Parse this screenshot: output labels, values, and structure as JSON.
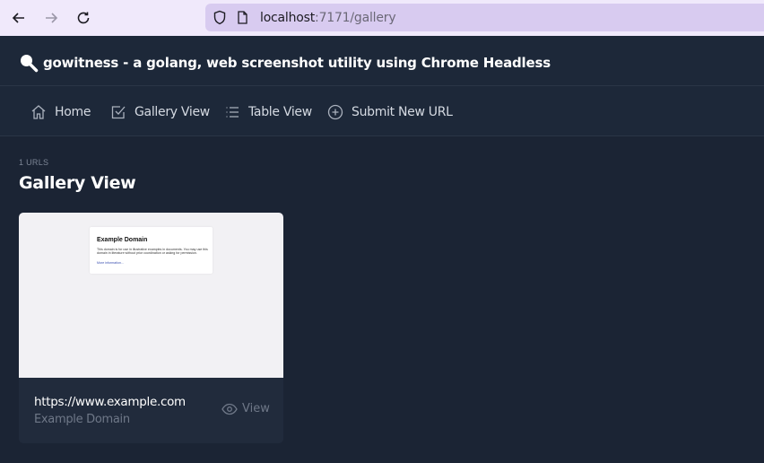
{
  "browser": {
    "url_host": "localhost",
    "url_path": ":7171/gallery"
  },
  "app": {
    "title": "gowitness - a golang, web screenshot utility using Chrome Headless"
  },
  "nav": {
    "items": [
      {
        "label": "Home",
        "icon": "home-icon"
      },
      {
        "label": "Gallery View",
        "icon": "check-square-icon"
      },
      {
        "label": "Table View",
        "icon": "list-icon"
      },
      {
        "label": "Submit New URL",
        "icon": "plus-circle-icon"
      }
    ]
  },
  "main": {
    "count_label": "1 URLS",
    "page_title": "Gallery View",
    "cards": [
      {
        "url": "https://www.example.com",
        "title": "Example Domain",
        "view_label": "View",
        "screenshot": {
          "heading": "Example Domain",
          "body": "This domain is for use in illustrative examples in documents. You may use this domain in literature without prior coordination or asking for permission.",
          "link": "More information..."
        }
      }
    ]
  },
  "colors": {
    "background": "#1b2434",
    "header": "#1d2839",
    "browser_bar": "#f0e9fb",
    "url_box": "#d8cbf0"
  }
}
